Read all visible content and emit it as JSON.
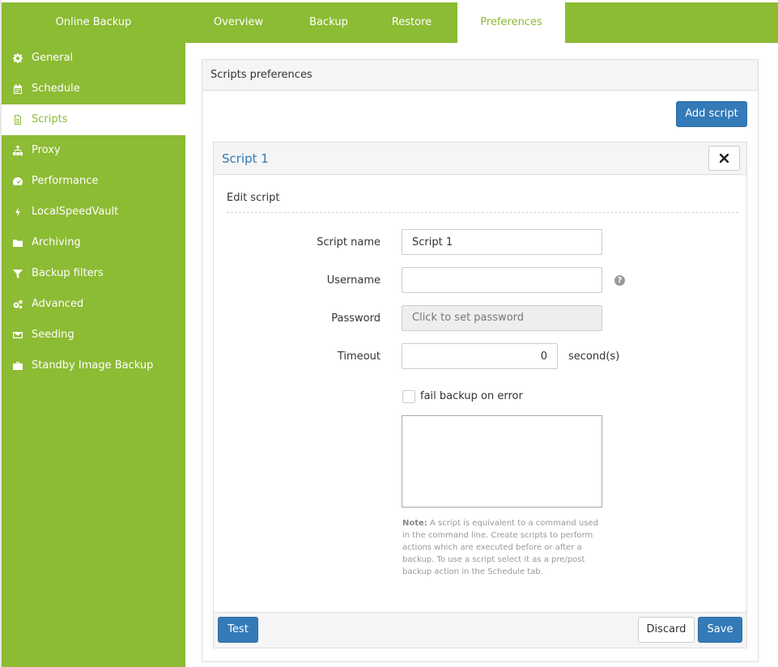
{
  "app": {
    "title": "Online Backup"
  },
  "tabs": [
    {
      "label": "Overview"
    },
    {
      "label": "Backup"
    },
    {
      "label": "Restore"
    },
    {
      "label": "Preferences"
    }
  ],
  "sidebar": {
    "items": [
      {
        "label": "General",
        "icon": "gear-icon"
      },
      {
        "label": "Schedule",
        "icon": "calendar-icon"
      },
      {
        "label": "Scripts",
        "icon": "file-text-icon"
      },
      {
        "label": "Proxy",
        "icon": "sitemap-icon"
      },
      {
        "label": "Performance",
        "icon": "dashboard-icon"
      },
      {
        "label": "LocalSpeedVault",
        "icon": "bolt-icon"
      },
      {
        "label": "Archiving",
        "icon": "folder-icon"
      },
      {
        "label": "Backup filters",
        "icon": "filter-icon"
      },
      {
        "label": "Advanced",
        "icon": "gears-icon"
      },
      {
        "label": "Seeding",
        "icon": "envelope-icon"
      },
      {
        "label": "Standby Image Backup",
        "icon": "briefcase-icon"
      }
    ],
    "active": "Scripts"
  },
  "panel": {
    "title": "Scripts preferences",
    "add_button": "Add script"
  },
  "script": {
    "title": "Script 1",
    "section_title": "Edit script",
    "fields": {
      "name_label": "Script name",
      "name_value": "Script 1",
      "username_label": "Username",
      "username_value": "",
      "password_label": "Password",
      "password_placeholder": "Click to set password",
      "timeout_label": "Timeout",
      "timeout_value": "0",
      "timeout_unit": "second(s)"
    },
    "fail_on_error_label": "fail backup on error",
    "fail_on_error_checked": false,
    "script_body": "",
    "note_bold": "Note:",
    "note_text": "A script is equivalent to a command used in the command line. Create scripts to perform actions which are executed before or after a backup. To use a script select it as a pre/post backup action in the Schedule tab.",
    "buttons": {
      "test": "Test",
      "discard": "Discard",
      "save": "Save"
    }
  },
  "colors": {
    "accent": "#8cbb34",
    "primary": "#337ab7"
  }
}
